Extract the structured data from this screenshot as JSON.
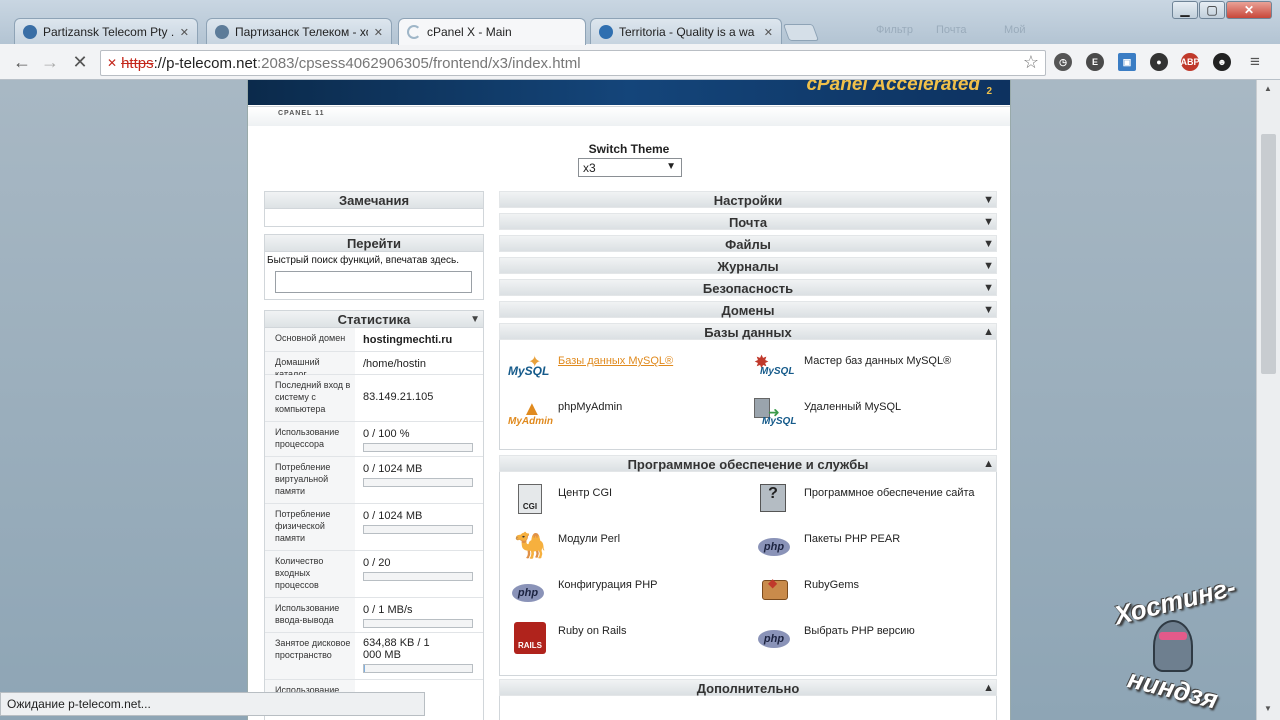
{
  "browser": {
    "tabs": [
      {
        "title": "Partizansk Telecom Pty .Lt",
        "favicon_color": "#3a6ea5"
      },
      {
        "title": "Партизанск Телеком - хо",
        "favicon_color": "#5d7c99"
      },
      {
        "title": "cPanel X - Main",
        "favicon_color": "#9fb6c8"
      },
      {
        "title": "Territoria - Quality is a wa",
        "favicon_color": "#2f6fb0"
      }
    ],
    "ghost_tabs": [
      "Фильтр",
      "Почта",
      "Мой"
    ],
    "url": {
      "scheme": "https",
      "host": "://p-telecom.net",
      "path": ":2083/cpsess4062906305/frontend/x3/index.html"
    },
    "extensions": [
      {
        "name": "clock-icon",
        "label": "◷",
        "color": "#555555"
      },
      {
        "name": "evernote-icon",
        "label": "E",
        "color": "#4a4a4a"
      },
      {
        "name": "folder-icon",
        "label": "▣",
        "color": "#3b7dc4"
      },
      {
        "name": "lastpass-icon",
        "label": "●",
        "color": "#333333"
      },
      {
        "name": "adblock-icon",
        "label": "ABP",
        "color": "#c0392b"
      },
      {
        "name": "ghost-icon",
        "label": "☻",
        "color": "#222222"
      }
    ],
    "status": "Ожидание p-telecom.net..."
  },
  "cpanel": {
    "brand": "cPanel Accelerated",
    "brand_sub": "2",
    "version": "CPANEL 11",
    "switch_theme_label": "Switch Theme",
    "theme_value": "x3",
    "notes_title": "Замечания",
    "goto_title": "Перейти",
    "goto_hint": "Быстрый поиск функций, впечатав здесь.",
    "stats_title": "Статистика",
    "stats": [
      {
        "key": "Основной домен",
        "value": "hostingmechti.ru",
        "bold": true
      },
      {
        "key": "Домашний каталог",
        "value": "/home/hostin"
      },
      {
        "key": "Последний вход в систему с компьютера",
        "value": "83.149.21.105"
      },
      {
        "key": "Использование процессора",
        "value": "0 / 100 %",
        "bar": 0.0
      },
      {
        "key": "Потребление виртуальной памяти",
        "value": "0 / 1024 MB",
        "bar": 0.0
      },
      {
        "key": "Потребление физической памяти",
        "value": "0 / 1024 MB",
        "bar": 0.0
      },
      {
        "key": "Количество входных процессов",
        "value": "0 / 20",
        "bar": 0.0
      },
      {
        "key": "Использование ввода-вывода",
        "value": "0 / 1 MB/s",
        "bar": 0.0
      },
      {
        "key": "Занятое дисковое пространство",
        "value": "634,88 KB / 1 000 MB",
        "bar": 0.006
      },
      {
        "key": "Использование",
        "value": ""
      }
    ],
    "sections_collapsed": [
      "Настройки",
      "Почта",
      "Файлы",
      "Журналы",
      "Безопасность",
      "Домены"
    ],
    "databases": {
      "title": "Базы данных",
      "items": [
        {
          "label": "Базы данных MySQL®",
          "icon": "mysql-icon"
        },
        {
          "label": "Мастер баз данных MySQL®",
          "icon": "mysql-wizard-icon"
        },
        {
          "label": "phpMyAdmin",
          "icon": "phpmyadmin-icon"
        },
        {
          "label": "Удаленный MySQL",
          "icon": "remote-mysql-icon"
        }
      ]
    },
    "software": {
      "title": "Программное обеспечение и службы",
      "items": [
        {
          "label": "Центр CGI",
          "icon": "cgi-icon"
        },
        {
          "label": "Программное обеспечение сайта",
          "icon": "site-software-icon"
        },
        {
          "label": "Модули Perl",
          "icon": "perl-camel-icon"
        },
        {
          "label": "Пакеты PHP PEAR",
          "icon": "php-pear-icon"
        },
        {
          "label": "Конфигурация PHP",
          "icon": "php-config-icon"
        },
        {
          "label": "RubyGems",
          "icon": "rubygems-icon"
        },
        {
          "label": "Ruby on Rails",
          "icon": "rails-icon"
        },
        {
          "label": "Выбрать PHP версию",
          "icon": "php-version-icon"
        }
      ]
    },
    "advanced_title": "Дополнительно"
  },
  "watermark": {
    "line1": "Хостинг-",
    "line2": "ниндзя"
  }
}
